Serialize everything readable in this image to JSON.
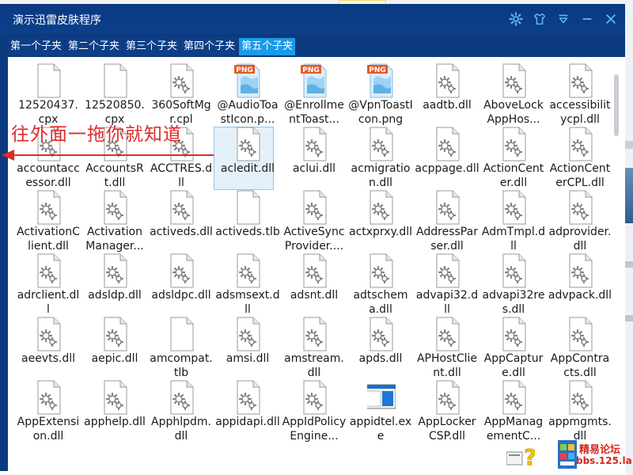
{
  "window": {
    "title": "演示迅雷皮肤程序"
  },
  "tabs": [
    "第一个子夹",
    "第二个子夹",
    "第三个子夹",
    "第四个子夹",
    "第五个子夹"
  ],
  "active_tab": 4,
  "annotation": "往外面一拖你就知道",
  "watermark": {
    "line1": "精易论坛",
    "line2": "bbs.125.la"
  },
  "files": [
    {
      "name": "12520437.cpx",
      "icon": "blank-file-icon"
    },
    {
      "name": "12520850.cpx",
      "icon": "blank-file-icon"
    },
    {
      "name": "360SoftMgr.cpl",
      "icon": "gear-file-icon"
    },
    {
      "name": "@AudioToastIcon.p...",
      "icon": "png-file-icon"
    },
    {
      "name": "@EnrollmentToast...",
      "icon": "png-file-icon"
    },
    {
      "name": "@VpnToastIcon.png",
      "icon": "png-file-icon"
    },
    {
      "name": "aadtb.dll",
      "icon": "gear-file-icon"
    },
    {
      "name": "AboveLockAppHos...",
      "icon": "gear-file-icon"
    },
    {
      "name": "accessibilitycpl.dll",
      "icon": "gear-file-icon"
    },
    {
      "name": "accountaccessor.dll",
      "icon": "gear-file-icon"
    },
    {
      "name": "AccountsRt.dll",
      "icon": "gear-file-icon"
    },
    {
      "name": "ACCTRES.dll",
      "icon": "gear-file-icon"
    },
    {
      "name": "acledit.dll",
      "icon": "gear-file-icon"
    },
    {
      "name": "aclui.dll",
      "icon": "gear-file-icon"
    },
    {
      "name": "acmigration.dll",
      "icon": "gear-file-icon"
    },
    {
      "name": "acppage.dll",
      "icon": "gear-file-icon"
    },
    {
      "name": "ActionCenter.dll",
      "icon": "gear-file-icon"
    },
    {
      "name": "ActionCenterCPL.dll",
      "icon": "gear-file-icon"
    },
    {
      "name": "ActivationClient.dll",
      "icon": "gear-file-icon"
    },
    {
      "name": "ActivationManager...",
      "icon": "gear-file-icon"
    },
    {
      "name": "activeds.dll",
      "icon": "gear-file-icon"
    },
    {
      "name": "activeds.tlb",
      "icon": "blank-file-icon"
    },
    {
      "name": "ActiveSyncProvider....",
      "icon": "gear-file-icon"
    },
    {
      "name": "actxprxy.dll",
      "icon": "gear-file-icon"
    },
    {
      "name": "AddressParser.dll",
      "icon": "gear-file-icon"
    },
    {
      "name": "AdmTmpl.dll",
      "icon": "gear-file-icon"
    },
    {
      "name": "adprovider.dll",
      "icon": "gear-file-icon"
    },
    {
      "name": "adrclient.dll",
      "icon": "gear-file-icon"
    },
    {
      "name": "adsldp.dll",
      "icon": "gear-file-icon"
    },
    {
      "name": "adsldpc.dll",
      "icon": "gear-file-icon"
    },
    {
      "name": "adsmsext.dll",
      "icon": "gear-file-icon"
    },
    {
      "name": "adsnt.dll",
      "icon": "gear-file-icon"
    },
    {
      "name": "adtschema.dll",
      "icon": "gear-file-icon"
    },
    {
      "name": "advapi32.dll",
      "icon": "gear-file-icon"
    },
    {
      "name": "advapi32res.dll",
      "icon": "gear-file-icon"
    },
    {
      "name": "advpack.dll",
      "icon": "gear-file-icon"
    },
    {
      "name": "aeevts.dll",
      "icon": "gear-file-icon"
    },
    {
      "name": "aepic.dll",
      "icon": "gear-file-icon"
    },
    {
      "name": "amcompat.tlb",
      "icon": "blank-file-icon"
    },
    {
      "name": "amsi.dll",
      "icon": "gear-file-icon"
    },
    {
      "name": "amstream.dll",
      "icon": "gear-file-icon"
    },
    {
      "name": "apds.dll",
      "icon": "gear-file-icon"
    },
    {
      "name": "APHostClient.dll",
      "icon": "gear-file-icon"
    },
    {
      "name": "AppCapture.dll",
      "icon": "gear-file-icon"
    },
    {
      "name": "AppContracts.dll",
      "icon": "gear-file-icon"
    },
    {
      "name": "AppExtension.dll",
      "icon": "gear-file-icon"
    },
    {
      "name": "apphelp.dll",
      "icon": "gear-file-icon"
    },
    {
      "name": "Apphlpdm.dll",
      "icon": "gear-file-icon"
    },
    {
      "name": "appidapi.dll",
      "icon": "gear-file-icon"
    },
    {
      "name": "AppIdPolicyEngine...",
      "icon": "gear-file-icon"
    },
    {
      "name": "appidtel.exe",
      "icon": "exe-window-icon"
    },
    {
      "name": "AppLockerCSP.dll",
      "icon": "gear-file-icon"
    },
    {
      "name": "AppManagementC...",
      "icon": "gear-file-icon"
    },
    {
      "name": "appmgmts.dll",
      "icon": "gear-file-icon"
    }
  ]
}
